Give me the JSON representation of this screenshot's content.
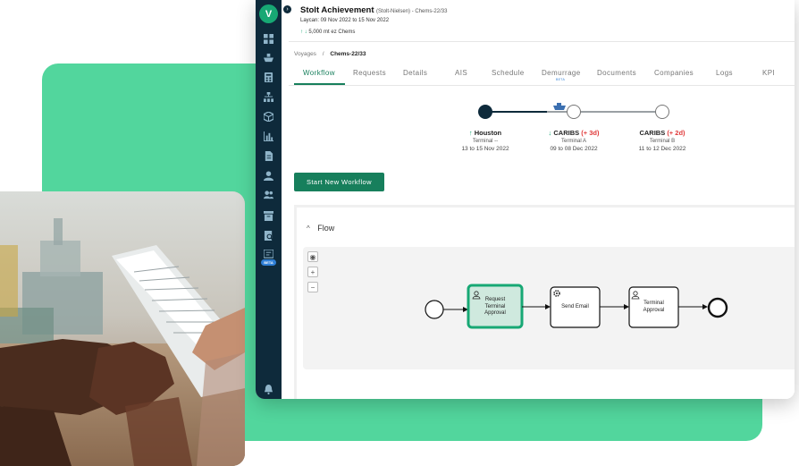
{
  "voyage": {
    "vessel": "Stolt Achievement",
    "operator_ref": "(Stolt-Nielsen) - Chems-22/33",
    "laycan": "Laycan: 09 Nov 2022 to 15 Nov 2022",
    "quantity": "5,000 mt ez Chems"
  },
  "breadcrumb": {
    "root": "Voyages",
    "separator": "/",
    "current": "Chems-22/33"
  },
  "tabs": [
    {
      "label": "Workflow"
    },
    {
      "label": "Requests"
    },
    {
      "label": "Details"
    },
    {
      "label": "AIS"
    },
    {
      "label": "Schedule"
    },
    {
      "label": "Demurrage",
      "badge": "BETA"
    },
    {
      "label": "Documents"
    },
    {
      "label": "Companies"
    },
    {
      "label": "Logs"
    },
    {
      "label": "KPI"
    }
  ],
  "sidebar": {
    "logo": "V",
    "beta_label": "BETA"
  },
  "ports": [
    {
      "arrow": "↑",
      "name": "Houston",
      "delay": "",
      "terminal": "Terminal --",
      "dates": "13 to 15 Nov 2022"
    },
    {
      "arrow": "↓",
      "name": "CARIBS",
      "delay": "(+ 3d)",
      "terminal": "Terminal A",
      "dates": "09 to 08 Dec 2022"
    },
    {
      "arrow": "",
      "name": "CARIBS",
      "delay": "(+ 2d)",
      "terminal": "Terminal B",
      "dates": "11 to 12 Dec 2022"
    }
  ],
  "actions": {
    "start_workflow": "Start New Workflow"
  },
  "flow": {
    "title": "Flow",
    "zoom_plus": "+",
    "zoom_minus": "−",
    "tasks": [
      {
        "line1": "Request",
        "line2": "Terminal",
        "line3": "Approval"
      },
      {
        "line1": "Send Email"
      },
      {
        "line1": "Terminal",
        "line2": "Approval"
      }
    ]
  },
  "colors": {
    "brand_green": "#177f5c",
    "sidebar_navy": "#0e2a3b",
    "delay_red": "#e03a3a",
    "active_task_fill": "#cfe9de",
    "background_green": "#52d69d"
  }
}
